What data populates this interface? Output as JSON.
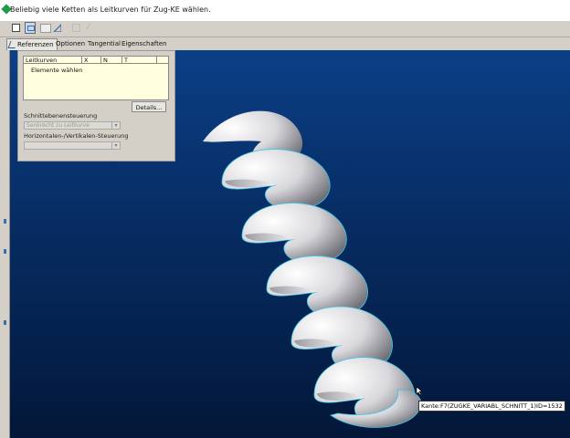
{
  "message": {
    "text": "Beliebig viele Ketten als Leitkurven für Zug-KE wählen."
  },
  "toolbar": {
    "icons": [
      "new-icon",
      "sweep-icon",
      "edit-icon",
      "chord-icon",
      "box-icon",
      "line-icon"
    ]
  },
  "tabs": [
    {
      "label": "Referenzen",
      "active": true
    },
    {
      "label": "Optionen",
      "active": false
    },
    {
      "label": "Tangential",
      "active": false
    },
    {
      "label": "Eigenschaften",
      "active": false
    }
  ],
  "references_panel": {
    "table": {
      "headers": [
        "Leitkurven",
        "X",
        "N",
        "T"
      ],
      "rows": [
        [
          "Elemente wählen",
          "",
          "",
          ""
        ]
      ]
    },
    "details_button": "Details...",
    "section_control_label": "Schnittebenensteuerung",
    "section_control_value": "Senkrecht zu Leitkurve",
    "hv_control_label": "Horizontalen-/Vertikalen-Steuerung",
    "hv_control_value": ""
  },
  "viewport": {
    "background": [
      "#0b3f86",
      "#031738"
    ],
    "edge_color": "#39c6e6",
    "tooltip": "Kante:F7(ZUGKE_VARIABL_SCHNITT_1)ID=1532"
  }
}
